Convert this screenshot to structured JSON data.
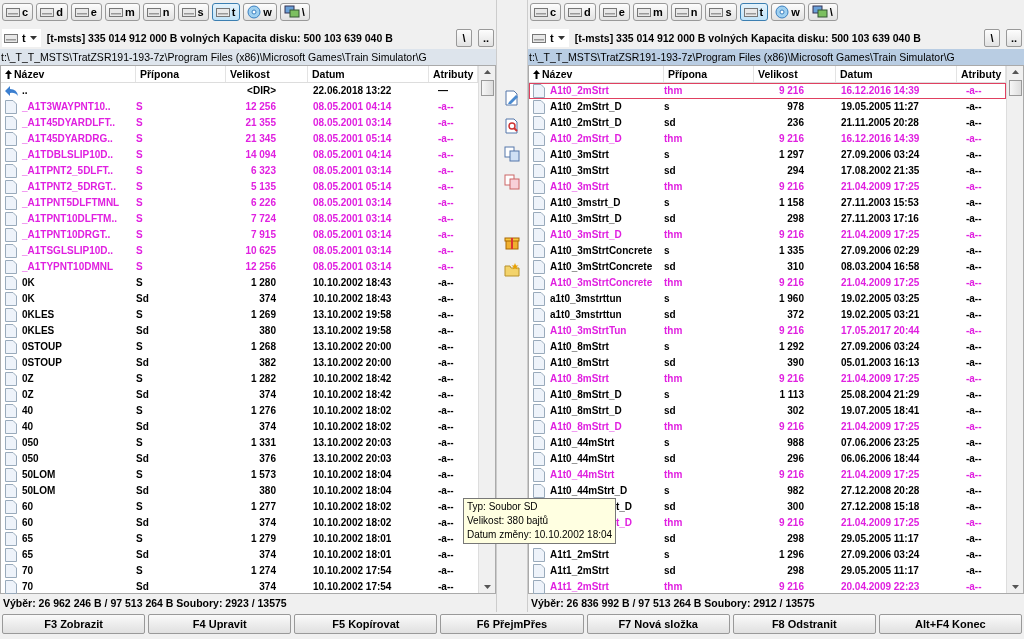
{
  "panels": [
    {
      "active": false,
      "drives": [
        {
          "label": "c",
          "kind": "disk",
          "selected": false
        },
        {
          "label": "d",
          "kind": "disk",
          "selected": false
        },
        {
          "label": "e",
          "kind": "disk",
          "selected": false
        },
        {
          "label": "m",
          "kind": "disk",
          "selected": false
        },
        {
          "label": "n",
          "kind": "disk",
          "selected": false
        },
        {
          "label": "s",
          "kind": "disk",
          "selected": false
        },
        {
          "label": "t",
          "kind": "disk",
          "selected": true
        },
        {
          "label": "w",
          "kind": "optical",
          "selected": false
        },
        {
          "label": "\\",
          "kind": "network",
          "selected": false
        }
      ],
      "drive_combo": "t",
      "drive_info": "[t-msts]  335 014 912 000 B volných  Kapacita disku: 500 103 639 040 B",
      "root_button": "\\",
      "up_button": "..",
      "path": "t:\\_T_T_MSTS\\TratZSR191-193-7z\\Program Files (x86)\\Microsoft Games\\Train Simulator\\G",
      "columns": [
        {
          "label": "Název",
          "sorted": true
        },
        {
          "label": "Přípona",
          "sorted": false
        },
        {
          "label": "Velikost",
          "sorted": false
        },
        {
          "label": "Datum",
          "sorted": false
        },
        {
          "label": "Atributy",
          "sorted": false
        }
      ],
      "rows": [
        {
          "kind": "parent",
          "name": "..",
          "ext": "",
          "size": "<DIR>",
          "date": "22.06.2018 13:22",
          "attr": "—",
          "color": "#000000",
          "selected": false
        },
        {
          "kind": "file",
          "name": "_A1T3WAYPNT10..",
          "ext": "S",
          "size": "12 256",
          "date": "08.05.2001 04:14",
          "attr": "-a--",
          "color": "#e020e0",
          "selected": false
        },
        {
          "kind": "file",
          "name": "_A1T45DYARDLFT..",
          "ext": "S",
          "size": "21 355",
          "date": "08.05.2001 03:14",
          "attr": "-a--",
          "color": "#e020e0",
          "selected": false
        },
        {
          "kind": "file",
          "name": "_A1T45DYARDRG..",
          "ext": "S",
          "size": "21 345",
          "date": "08.05.2001 05:14",
          "attr": "-a--",
          "color": "#e020e0",
          "selected": false
        },
        {
          "kind": "file",
          "name": "_A1TDBLSLIP10D..",
          "ext": "S",
          "size": "14 094",
          "date": "08.05.2001 04:14",
          "attr": "-a--",
          "color": "#e020e0",
          "selected": false
        },
        {
          "kind": "file",
          "name": "_A1TPNT2_5DLFT..",
          "ext": "S",
          "size": "6 323",
          "date": "08.05.2001 03:14",
          "attr": "-a--",
          "color": "#e020e0",
          "selected": false
        },
        {
          "kind": "file",
          "name": "_A1TPNT2_5DRGT..",
          "ext": "S",
          "size": "5 135",
          "date": "08.05.2001 05:14",
          "attr": "-a--",
          "color": "#e020e0",
          "selected": false
        },
        {
          "kind": "file",
          "name": "_A1TPNT5DLFTMNL",
          "ext": "S",
          "size": "6 226",
          "date": "08.05.2001 03:14",
          "attr": "-a--",
          "color": "#e020e0",
          "selected": false
        },
        {
          "kind": "file",
          "name": "_A1TPNT10DLFTM..",
          "ext": "S",
          "size": "7 724",
          "date": "08.05.2001 03:14",
          "attr": "-a--",
          "color": "#e020e0",
          "selected": false
        },
        {
          "kind": "file",
          "name": "_A1TPNT10DRGT..",
          "ext": "S",
          "size": "7 915",
          "date": "08.05.2001 03:14",
          "attr": "-a--",
          "color": "#e020e0",
          "selected": false
        },
        {
          "kind": "file",
          "name": "_A1TSGLSLIP10D..",
          "ext": "S",
          "size": "10 625",
          "date": "08.05.2001 03:14",
          "attr": "-a--",
          "color": "#e020e0",
          "selected": false
        },
        {
          "kind": "file",
          "name": "_A1TYPNT10DMNL",
          "ext": "S",
          "size": "12 256",
          "date": "08.05.2001 03:14",
          "attr": "-a--",
          "color": "#e020e0",
          "selected": false
        },
        {
          "kind": "file",
          "name": "0K",
          "ext": "S",
          "size": "1 280",
          "date": "10.10.2002 18:43",
          "attr": "-a--",
          "color": "#000000",
          "selected": false
        },
        {
          "kind": "file",
          "name": "0K",
          "ext": "Sd",
          "size": "374",
          "date": "10.10.2002 18:43",
          "attr": "-a--",
          "color": "#000000",
          "selected": false
        },
        {
          "kind": "file",
          "name": "0KLES",
          "ext": "S",
          "size": "1 269",
          "date": "13.10.2002 19:58",
          "attr": "-a--",
          "color": "#000000",
          "selected": false
        },
        {
          "kind": "file",
          "name": "0KLES",
          "ext": "Sd",
          "size": "380",
          "date": "13.10.2002 19:58",
          "attr": "-a--",
          "color": "#000000",
          "selected": false
        },
        {
          "kind": "file",
          "name": "0STOUP",
          "ext": "S",
          "size": "1 268",
          "date": "13.10.2002 20:00",
          "attr": "-a--",
          "color": "#000000",
          "selected": false
        },
        {
          "kind": "file",
          "name": "0STOUP",
          "ext": "Sd",
          "size": "382",
          "date": "13.10.2002 20:00",
          "attr": "-a--",
          "color": "#000000",
          "selected": false
        },
        {
          "kind": "file",
          "name": "0Z",
          "ext": "S",
          "size": "1 282",
          "date": "10.10.2002 18:42",
          "attr": "-a--",
          "color": "#000000",
          "selected": false
        },
        {
          "kind": "file",
          "name": "0Z",
          "ext": "Sd",
          "size": "374",
          "date": "10.10.2002 18:42",
          "attr": "-a--",
          "color": "#000000",
          "selected": false
        },
        {
          "kind": "file",
          "name": "40",
          "ext": "S",
          "size": "1 276",
          "date": "10.10.2002 18:02",
          "attr": "-a--",
          "color": "#000000",
          "selected": false
        },
        {
          "kind": "file",
          "name": "40",
          "ext": "Sd",
          "size": "374",
          "date": "10.10.2002 18:02",
          "attr": "-a--",
          "color": "#000000",
          "selected": false
        },
        {
          "kind": "file",
          "name": "050",
          "ext": "S",
          "size": "1 331",
          "date": "13.10.2002 20:03",
          "attr": "-a--",
          "color": "#000000",
          "selected": false
        },
        {
          "kind": "file",
          "name": "050",
          "ext": "Sd",
          "size": "376",
          "date": "13.10.2002 20:03",
          "attr": "-a--",
          "color": "#000000",
          "selected": false
        },
        {
          "kind": "file",
          "name": "50LOM",
          "ext": "S",
          "size": "1 573",
          "date": "10.10.2002 18:04",
          "attr": "-a--",
          "color": "#000000",
          "selected": false
        },
        {
          "kind": "file",
          "name": "50LOM",
          "ext": "Sd",
          "size": "380",
          "date": "10.10.2002 18:04",
          "attr": "-a--",
          "color": "#000000",
          "selected": false
        },
        {
          "kind": "file",
          "name": "60",
          "ext": "S",
          "size": "1 277",
          "date": "10.10.2002 18:02",
          "attr": "-a--",
          "color": "#000000",
          "selected": false
        },
        {
          "kind": "file",
          "name": "60",
          "ext": "Sd",
          "size": "374",
          "date": "10.10.2002 18:02",
          "attr": "-a--",
          "color": "#000000",
          "selected": false
        },
        {
          "kind": "file",
          "name": "65",
          "ext": "S",
          "size": "1 279",
          "date": "10.10.2002 18:01",
          "attr": "-a--",
          "color": "#000000",
          "selected": false
        },
        {
          "kind": "file",
          "name": "65",
          "ext": "Sd",
          "size": "374",
          "date": "10.10.2002 18:01",
          "attr": "-a--",
          "color": "#000000",
          "selected": false
        },
        {
          "kind": "file",
          "name": "70",
          "ext": "S",
          "size": "1 274",
          "date": "10.10.2002 17:54",
          "attr": "-a--",
          "color": "#000000",
          "selected": false
        },
        {
          "kind": "file",
          "name": "70",
          "ext": "Sd",
          "size": "374",
          "date": "10.10.2002 17:54",
          "attr": "-a--",
          "color": "#000000",
          "selected": false
        }
      ],
      "status": "Výběr: 26 962 246 B / 97 513 264 B  Soubory: 2923 / 13575"
    },
    {
      "active": true,
      "drives": [
        {
          "label": "c",
          "kind": "disk",
          "selected": false
        },
        {
          "label": "d",
          "kind": "disk",
          "selected": false
        },
        {
          "label": "e",
          "kind": "disk",
          "selected": false
        },
        {
          "label": "m",
          "kind": "disk",
          "selected": false
        },
        {
          "label": "n",
          "kind": "disk",
          "selected": false
        },
        {
          "label": "s",
          "kind": "disk",
          "selected": false
        },
        {
          "label": "t",
          "kind": "disk",
          "selected": true
        },
        {
          "label": "w",
          "kind": "optical",
          "selected": false
        },
        {
          "label": "\\",
          "kind": "network",
          "selected": false
        }
      ],
      "drive_combo": "t",
      "drive_info": "[t-msts]  335 014 912 000 B volných  Kapacita disku: 500 103 639 040 B",
      "root_button": "\\",
      "up_button": "..",
      "path": "t:\\_T_T_MSTS\\TratZSR191-193-7z\\Program Files (x86)\\Microsoft Games\\Train Simulator\\G",
      "columns": [
        {
          "label": "Název",
          "sorted": true
        },
        {
          "label": "Přípona",
          "sorted": false
        },
        {
          "label": "Velikost",
          "sorted": false
        },
        {
          "label": "Datum",
          "sorted": false
        },
        {
          "label": "Atributy",
          "sorted": false
        }
      ],
      "rows": [
        {
          "kind": "file",
          "name": "A1t0_2mStrt",
          "ext": "thm",
          "size": "9 216",
          "date": "16.12.2016 14:39",
          "attr": "-a--",
          "color": "#e020e0",
          "selected": true
        },
        {
          "kind": "file",
          "name": "A1t0_2mStrt_D",
          "ext": "s",
          "size": "978",
          "date": "19.05.2005 11:27",
          "attr": "-a--",
          "color": "#000000",
          "selected": false
        },
        {
          "kind": "file",
          "name": "A1t0_2mStrt_D",
          "ext": "sd",
          "size": "236",
          "date": "21.11.2005 20:28",
          "attr": "-a--",
          "color": "#000000",
          "selected": false
        },
        {
          "kind": "file",
          "name": "A1t0_2mStrt_D",
          "ext": "thm",
          "size": "9 216",
          "date": "16.12.2016 14:39",
          "attr": "-a--",
          "color": "#e020e0",
          "selected": false
        },
        {
          "kind": "file",
          "name": "A1t0_3mStrt",
          "ext": "s",
          "size": "1 297",
          "date": "27.09.2006 03:24",
          "attr": "-a--",
          "color": "#000000",
          "selected": false
        },
        {
          "kind": "file",
          "name": "A1t0_3mStrt",
          "ext": "sd",
          "size": "294",
          "date": "17.08.2002 21:35",
          "attr": "-a--",
          "color": "#000000",
          "selected": false
        },
        {
          "kind": "file",
          "name": "A1t0_3mStrt",
          "ext": "thm",
          "size": "9 216",
          "date": "21.04.2009 17:25",
          "attr": "-a--",
          "color": "#e020e0",
          "selected": false
        },
        {
          "kind": "file",
          "name": "A1t0_3mstrt_D",
          "ext": "s",
          "size": "1 158",
          "date": "27.11.2003 15:53",
          "attr": "-a--",
          "color": "#000000",
          "selected": false
        },
        {
          "kind": "file",
          "name": "A1t0_3mStrt_D",
          "ext": "sd",
          "size": "298",
          "date": "27.11.2003 17:16",
          "attr": "-a--",
          "color": "#000000",
          "selected": false
        },
        {
          "kind": "file",
          "name": "A1t0_3mStrt_D",
          "ext": "thm",
          "size": "9 216",
          "date": "21.04.2009 17:25",
          "attr": "-a--",
          "color": "#e020e0",
          "selected": false
        },
        {
          "kind": "file",
          "name": "A1t0_3mStrtConcrete",
          "ext": "s",
          "size": "1 335",
          "date": "27.09.2006 02:29",
          "attr": "-a--",
          "color": "#000000",
          "selected": false
        },
        {
          "kind": "file",
          "name": "A1t0_3mStrtConcrete",
          "ext": "sd",
          "size": "310",
          "date": "08.03.2004 16:58",
          "attr": "-a--",
          "color": "#000000",
          "selected": false
        },
        {
          "kind": "file",
          "name": "A1t0_3mStrtConcrete",
          "ext": "thm",
          "size": "9 216",
          "date": "21.04.2009 17:25",
          "attr": "-a--",
          "color": "#e020e0",
          "selected": false
        },
        {
          "kind": "file",
          "name": "a1t0_3mstrttun",
          "ext": "s",
          "size": "1 960",
          "date": "19.02.2005 03:25",
          "attr": "-a--",
          "color": "#000000",
          "selected": false
        },
        {
          "kind": "file",
          "name": "a1t0_3mstrttun",
          "ext": "sd",
          "size": "372",
          "date": "19.02.2005 03:21",
          "attr": "-a--",
          "color": "#000000",
          "selected": false
        },
        {
          "kind": "file",
          "name": "A1t0_3mStrtTun",
          "ext": "thm",
          "size": "9 216",
          "date": "17.05.2017 20:44",
          "attr": "-a--",
          "color": "#e020e0",
          "selected": false
        },
        {
          "kind": "file",
          "name": "A1t0_8mStrt",
          "ext": "s",
          "size": "1 292",
          "date": "27.09.2006 03:24",
          "attr": "-a--",
          "color": "#000000",
          "selected": false
        },
        {
          "kind": "file",
          "name": "A1t0_8mStrt",
          "ext": "sd",
          "size": "390",
          "date": "05.01.2003 16:13",
          "attr": "-a--",
          "color": "#000000",
          "selected": false
        },
        {
          "kind": "file",
          "name": "A1t0_8mStrt",
          "ext": "thm",
          "size": "9 216",
          "date": "21.04.2009 17:25",
          "attr": "-a--",
          "color": "#e020e0",
          "selected": false
        },
        {
          "kind": "file",
          "name": "A1t0_8mStrt_D",
          "ext": "s",
          "size": "1 113",
          "date": "25.08.2004 21:29",
          "attr": "-a--",
          "color": "#000000",
          "selected": false
        },
        {
          "kind": "file",
          "name": "A1t0_8mStrt_D",
          "ext": "sd",
          "size": "302",
          "date": "19.07.2005 18:41",
          "attr": "-a--",
          "color": "#000000",
          "selected": false
        },
        {
          "kind": "file",
          "name": "A1t0_8mStrt_D",
          "ext": "thm",
          "size": "9 216",
          "date": "21.04.2009 17:25",
          "attr": "-a--",
          "color": "#e020e0",
          "selected": false
        },
        {
          "kind": "file",
          "name": "A1t0_44mStrt",
          "ext": "s",
          "size": "988",
          "date": "07.06.2006 23:25",
          "attr": "-a--",
          "color": "#000000",
          "selected": false
        },
        {
          "kind": "file",
          "name": "A1t0_44mStrt",
          "ext": "sd",
          "size": "296",
          "date": "06.06.2006 18:44",
          "attr": "-a--",
          "color": "#000000",
          "selected": false
        },
        {
          "kind": "file",
          "name": "A1t0_44mStrt",
          "ext": "thm",
          "size": "9 216",
          "date": "21.04.2009 17:25",
          "attr": "-a--",
          "color": "#e020e0",
          "selected": false
        },
        {
          "kind": "file",
          "name": "A1t0_44mStrt_D",
          "ext": "s",
          "size": "982",
          "date": "27.12.2008 20:28",
          "attr": "-a--",
          "color": "#000000",
          "selected": false
        },
        {
          "kind": "covered",
          "name": "t_D",
          "ext": "sd",
          "size": "300",
          "date": "27.12.2008 15:18",
          "attr": "-a--",
          "color": "#000000",
          "selected": false
        },
        {
          "kind": "covered",
          "name": "t_D",
          "ext": "thm",
          "size": "9 216",
          "date": "21.04.2009 17:25",
          "attr": "-a--",
          "color": "#e020e0",
          "selected": false
        },
        {
          "kind": "covered",
          "name": "",
          "ext": "sd",
          "size": "298",
          "date": "29.05.2005 11:17",
          "attr": "-a--",
          "color": "#000000",
          "selected": false
        },
        {
          "kind": "file",
          "name": "A1t1_2mStrt",
          "ext": "s",
          "size": "1 296",
          "date": "27.09.2006 03:24",
          "attr": "-a--",
          "color": "#000000",
          "selected": false
        },
        {
          "kind": "file",
          "name": "A1t1_2mStrt",
          "ext": "sd",
          "size": "298",
          "date": "29.05.2005 11:17",
          "attr": "-a--",
          "color": "#000000",
          "selected": false
        },
        {
          "kind": "file",
          "name": "A1t1_2mStrt",
          "ext": "thm",
          "size": "9 216",
          "date": "20.04.2009 22:23",
          "attr": "-a--",
          "color": "#e020e0",
          "selected": false
        }
      ],
      "status": "Výběr: 26 836 992 B / 97 513 264 B  Soubory: 2912 / 13575"
    }
  ],
  "tooltip": {
    "lines": [
      "Typ: Soubor SD",
      "Velikost: 380 bajtů",
      "Datum změny: 10.10.2002 18:04"
    ]
  },
  "function_keys": [
    "F3 Zobrazit",
    "F4 Upravit",
    "F5 Kopírovat",
    "F6 PřejmPřes",
    "F7 Nová složka",
    "F8 Odstranit",
    "Alt+F4 Konec"
  ]
}
